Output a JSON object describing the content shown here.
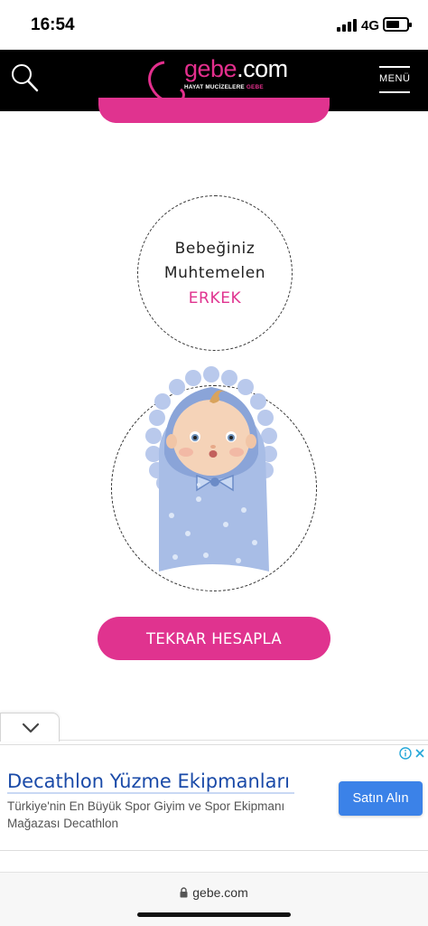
{
  "status_bar": {
    "time": "16:54",
    "network": "4G",
    "icons": [
      "signal-icon",
      "battery-icon"
    ]
  },
  "header": {
    "logo_prefix": "gebe",
    "logo_suffix": ".com",
    "tagline_main": "HAYAT MUCİZELERE",
    "tagline_accent": "GEBE",
    "menu_label": "MENÜ",
    "icons": [
      "search-icon"
    ],
    "colors": {
      "background": "#000000",
      "brand_pink": "#e32f8d"
    }
  },
  "result": {
    "line1": "Bebeğiniz",
    "line2": "Muhtemelen",
    "gender": "ERKEK",
    "accent_color": "#e0338f"
  },
  "illustration": {
    "name": "baby-boy-illustration",
    "colors": {
      "swaddle": "#a8bde6",
      "hood": "#8aa4d8",
      "skin": "#f5d3b8"
    }
  },
  "actions": {
    "recalc_label": "TEKRAR HESAPLA"
  },
  "ad": {
    "title": "Decathlon Yüzme Ekipmanları",
    "description": "Türkiye'nin En Büyük Spor Giyim ve Spor Ekipmanı Mağazası Decathlon",
    "cta_label": "Satın Alın",
    "icons": [
      "chevron-down-icon",
      "info-icon",
      "close-icon"
    ],
    "colors": {
      "title": "#1a4aa8",
      "cta": "#3b82e8"
    }
  },
  "browser": {
    "url": "gebe.com",
    "icons": [
      "lock-icon"
    ]
  }
}
